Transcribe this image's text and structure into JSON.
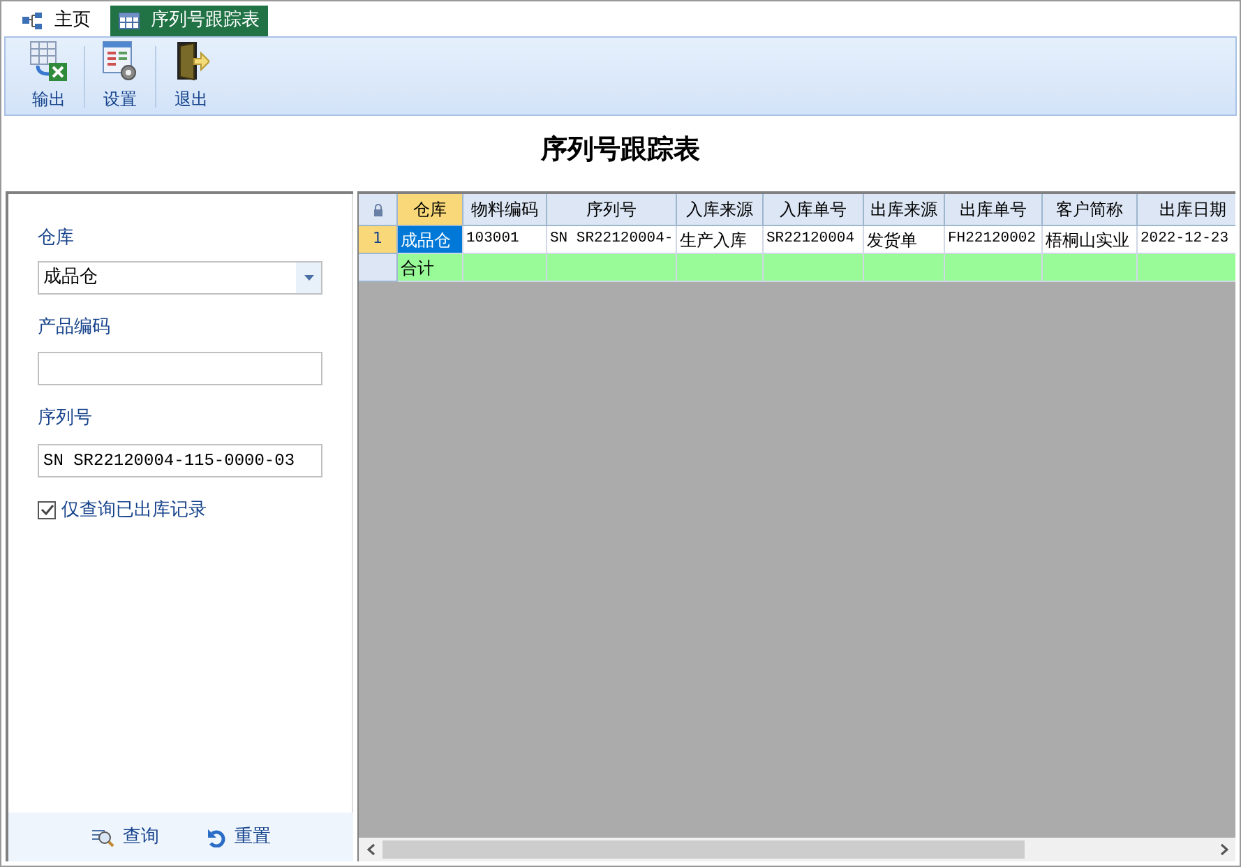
{
  "tabs": [
    {
      "label": "主页",
      "selected": false
    },
    {
      "label": "序列号跟踪表",
      "selected": true
    }
  ],
  "toolbar": [
    {
      "label": "输出"
    },
    {
      "label": "设置"
    },
    {
      "label": "退出"
    }
  ],
  "page_title": "序列号跟踪表",
  "filters": [
    {
      "kind": "dropdown",
      "label": "仓库",
      "value": "成品仓"
    },
    {
      "kind": "text",
      "label": "产品编码"
    },
    {
      "kind": "text",
      "label": "序列号",
      "value": "SN SR22120004-115-0000-03"
    },
    {
      "kind": "checkbox",
      "label": "仅查询已出库记录",
      "checked": true
    }
  ],
  "filter_buttons": [
    {
      "label": "查询"
    },
    {
      "label": "重置"
    }
  ],
  "table": {
    "columns": [
      {
        "label": "仓库",
        "selected": true
      },
      {
        "label": "物料编码",
        "selected": false
      },
      {
        "label": "序列号",
        "selected": false
      },
      {
        "label": "入库来源",
        "selected": false
      },
      {
        "label": "入库单号",
        "selected": false
      },
      {
        "label": "出库来源",
        "selected": false
      },
      {
        "label": "出库单号",
        "selected": false
      },
      {
        "label": "客户简称",
        "selected": false
      },
      {
        "label": "出库日期",
        "selected": false
      }
    ],
    "rows": [
      {
        "kind": "data",
        "number": "1",
        "selected": true,
        "cells": [
          "成品仓",
          "103001",
          "SN SR22120004-",
          "生产入库",
          "SR22120004",
          "发货单",
          "FH22120002",
          "梧桐山实业",
          "2022-12-23"
        ]
      },
      {
        "kind": "total",
        "selected": false,
        "cells": [
          "合计",
          null,
          null,
          null,
          null,
          null,
          null,
          null,
          null
        ]
      }
    ]
  }
}
